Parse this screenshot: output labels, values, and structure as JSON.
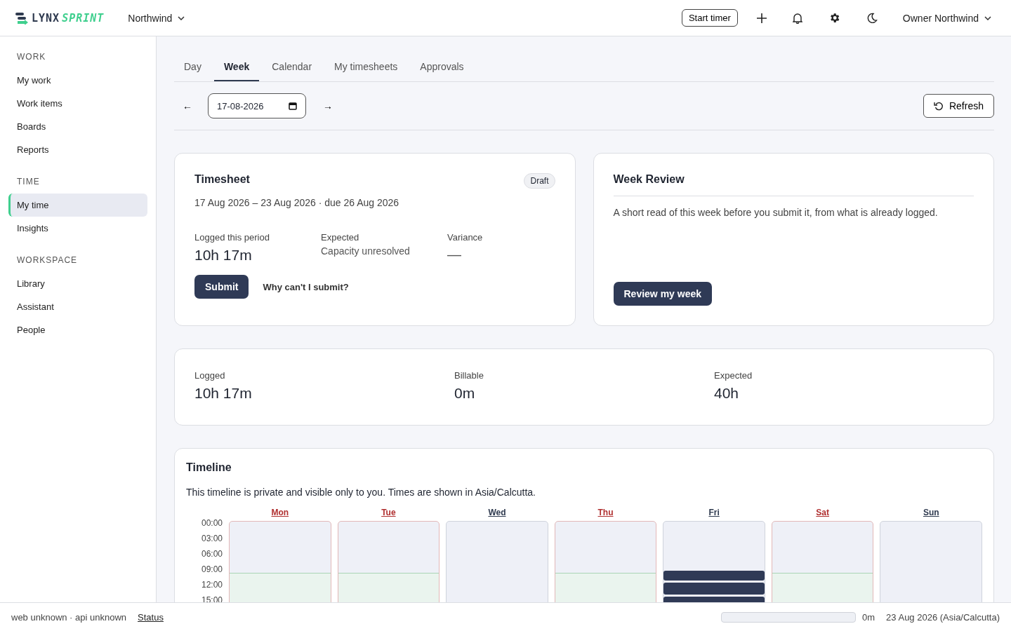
{
  "header": {
    "logo_main": "LYNX",
    "logo_accent": "SPRINT",
    "org": "Northwind",
    "start_timer": "Start timer",
    "user": "Owner Northwind"
  },
  "sidebar": {
    "sections": [
      {
        "title": "WORK",
        "items": [
          {
            "label": "My work",
            "selected": false
          },
          {
            "label": "Work items",
            "selected": false
          },
          {
            "label": "Boards",
            "selected": false
          },
          {
            "label": "Reports",
            "selected": false
          }
        ]
      },
      {
        "title": "TIME",
        "items": [
          {
            "label": "My time",
            "selected": true
          },
          {
            "label": "Insights",
            "selected": false
          }
        ]
      },
      {
        "title": "WORKSPACE",
        "items": [
          {
            "label": "Library",
            "selected": false
          },
          {
            "label": "Assistant",
            "selected": false
          },
          {
            "label": "People",
            "selected": false
          }
        ]
      }
    ]
  },
  "tabs": [
    {
      "label": "Day",
      "selected": false
    },
    {
      "label": "Week",
      "selected": true
    },
    {
      "label": "Calendar",
      "selected": false
    },
    {
      "label": "My timesheets",
      "selected": false
    },
    {
      "label": "Approvals",
      "selected": false
    }
  ],
  "toolbar": {
    "prev": "←",
    "date": "17-08-2026",
    "next": "→",
    "refresh": "Refresh"
  },
  "timesheet": {
    "title": "Timesheet",
    "status": "Draft",
    "period": "17 Aug 2026 – 23 Aug 2026 · due 26 Aug 2026",
    "stats": [
      {
        "label": "Logged this period",
        "value": "10h 17m",
        "kind": "big"
      },
      {
        "label": "Expected",
        "value": "Capacity unresolved",
        "kind": "small"
      },
      {
        "label": "Variance",
        "value": "—",
        "kind": "dash"
      }
    ],
    "submit": "Submit",
    "why": "Why can't I submit?"
  },
  "review": {
    "title": "Week Review",
    "text": "A short read of this week before you submit it, from what is already logged.",
    "button": "Review my week"
  },
  "summary": [
    {
      "label": "Logged",
      "value": "10h 17m"
    },
    {
      "label": "Billable",
      "value": "0m"
    },
    {
      "label": "Expected",
      "value": "40h"
    }
  ],
  "timeline": {
    "title": "Timeline",
    "note": "This timeline is private and visible only to you. Times are shown in Asia/Calcutta.",
    "hours": [
      "00:00",
      "03:00",
      "06:00",
      "09:00",
      "12:00",
      "15:00"
    ],
    "days": [
      {
        "label": "Mon",
        "flagged": true,
        "work_hours": true,
        "busy": false
      },
      {
        "label": "Tue",
        "flagged": true,
        "work_hours": true,
        "busy": false
      },
      {
        "label": "Wed",
        "flagged": false,
        "work_hours": false,
        "busy": false
      },
      {
        "label": "Thu",
        "flagged": true,
        "work_hours": true,
        "busy": false
      },
      {
        "label": "Fri",
        "flagged": false,
        "work_hours": false,
        "busy": true
      },
      {
        "label": "Sat",
        "flagged": true,
        "work_hours": true,
        "busy": false
      },
      {
        "label": "Sun",
        "flagged": false,
        "work_hours": false,
        "busy": false
      }
    ]
  },
  "footer": {
    "version": "web unknown · api unknown",
    "status_link": "Status",
    "level": 0,
    "reading": "0m",
    "date": "23 Aug 2026 (Asia/Calcutta)"
  }
}
